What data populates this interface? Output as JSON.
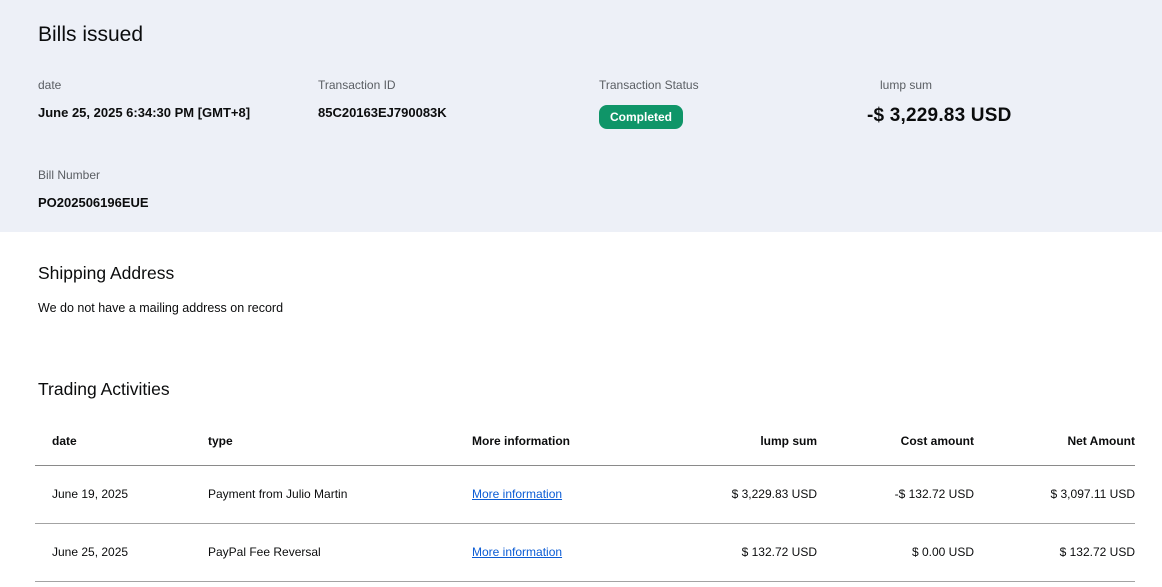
{
  "page": {
    "title": "Bills issued"
  },
  "summary": {
    "fields": [
      {
        "label": "date",
        "value": "June 25, 2025 6:34:30 PM [GMT+8]"
      },
      {
        "label": "Transaction ID",
        "value": "85C20163EJ790083K"
      },
      {
        "label": "Transaction Status",
        "value": "Completed"
      },
      {
        "label": "lump sum",
        "value": "-$ 3,229.83 USD"
      },
      {
        "label": "Bill Number",
        "value": "PO202506196EUE"
      }
    ]
  },
  "shipping": {
    "heading": "Shipping Address",
    "message": "We do not have a mailing address on record"
  },
  "trading": {
    "heading": "Trading Activities",
    "columns": [
      "date",
      "type",
      "More information",
      "lump sum",
      "Cost amount",
      "Net Amount"
    ],
    "rows": [
      {
        "date": "June 19, 2025",
        "type": "Payment from Julio Martin",
        "link": "More information",
        "lump_sum": "$ 3,229.83 USD",
        "cost_amount": "-$ 132.72 USD",
        "net_amount": "$ 3,097.11 USD"
      },
      {
        "date": "June 25, 2025",
        "type": "PayPal Fee Reversal",
        "link": "More information",
        "lump_sum": "$ 132.72 USD",
        "cost_amount": "$ 0.00 USD",
        "net_amount": "$ 132.72 USD"
      }
    ]
  },
  "colors": {
    "hero_bg": "#edf0f7",
    "badge_green": "#0f9568",
    "link_blue": "#0b5cd5"
  }
}
